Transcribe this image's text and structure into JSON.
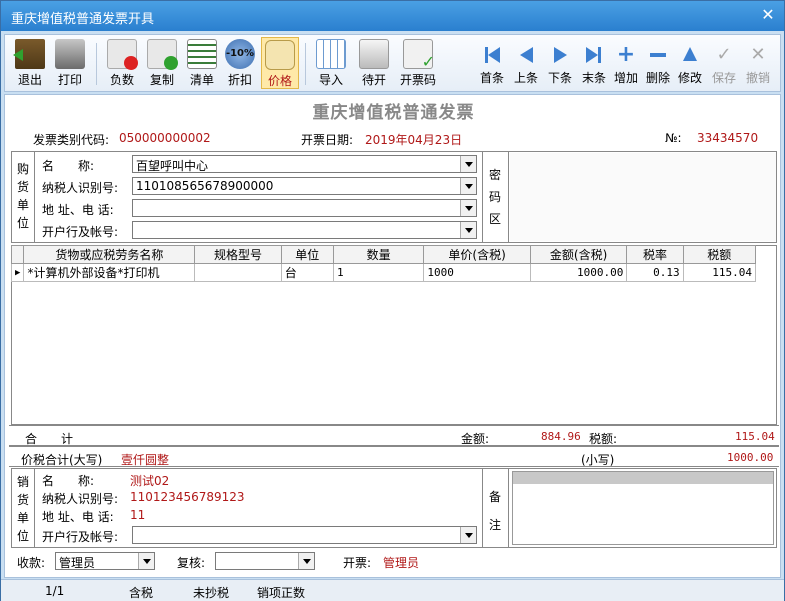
{
  "window": {
    "title": "重庆增值税普通发票开具",
    "close_icon": "close-icon"
  },
  "toolbar": {
    "exit": "退出",
    "print": "打印",
    "negative": "负数",
    "copy": "复制",
    "list": "清单",
    "discount": "折扣",
    "discount_badge": "-10%",
    "price": "价格",
    "import": "导入",
    "pending": "待开",
    "invoice_code": "开票码",
    "first": "首条",
    "prev": "上条",
    "next": "下条",
    "last": "末条",
    "add": "增加",
    "delete": "删除",
    "modify": "修改",
    "save": "保存",
    "undo": "撤销"
  },
  "invoice": {
    "title": "重庆增值税普通发票",
    "type_code_label": "发票类别代码:",
    "type_code": "050000000002",
    "date_label": "开票日期:",
    "date": "2019年04月23日",
    "number_label": "№:",
    "number": "33434570"
  },
  "buyer": {
    "side_label": [
      "购",
      "货",
      "单",
      "位"
    ],
    "name_label": "名　　称:",
    "name": "百望呼叫中心",
    "tax_id_label": "纳税人识别号:",
    "tax_id": "110108565678900000",
    "address_label": "地 址、电 话:",
    "address": "",
    "bank_label": "开户行及帐号:",
    "bank": ""
  },
  "cipher": {
    "label": [
      "密",
      "码",
      "区"
    ]
  },
  "items": {
    "columns": [
      "货物或应税劳务名称",
      "规格型号",
      "单位",
      "数量",
      "单价(含税)",
      "金额(含税)",
      "税率",
      "税额"
    ],
    "rows": [
      [
        "*计算机外部设备*打印机",
        "",
        "台",
        "1",
        "1000",
        "1000.00",
        "0.13",
        "115.04"
      ]
    ]
  },
  "totals": {
    "total_label": "合　　计",
    "amount_label": "金额:",
    "amount": "884.96",
    "tax_label": "税额:",
    "tax": "115.04",
    "sum_label": "价税合计(大写)",
    "sum_upper": "壹仟圆整",
    "sum_small_label": "(小写)",
    "sum_small": "1000.00"
  },
  "seller": {
    "side_label": [
      "销",
      "货",
      "单",
      "位"
    ],
    "name_label": "名　　称:",
    "name": "测试02",
    "tax_id_label": "纳税人识别号:",
    "tax_id": "110123456789123",
    "address_label": "地 址、电 话:",
    "address": "11",
    "bank_label": "开户行及帐号:",
    "bank": ""
  },
  "remarks": {
    "label": [
      "备",
      "注"
    ]
  },
  "footer": {
    "payee_label": "收款:",
    "payee": "管理员",
    "reviewer_label": "复核:",
    "reviewer": "",
    "issuer_label": "开票:",
    "issuer": "管理员"
  },
  "status": {
    "page": "1/1",
    "tax_mode": "含税",
    "copy_status": "未抄税",
    "sale_type": "销项正数"
  },
  "colors": {
    "accent_red": "#b01818",
    "titlebar": "#2a7fcf",
    "window_bg": "#c9dff2"
  }
}
